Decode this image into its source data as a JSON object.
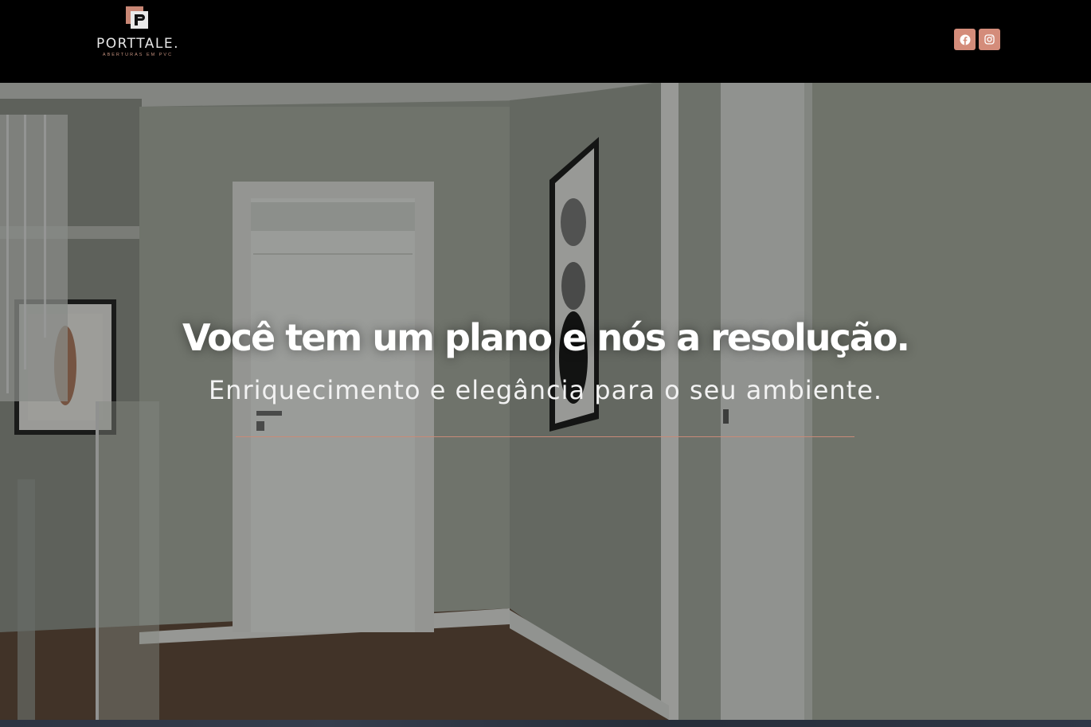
{
  "header": {
    "logo": {
      "icon": "porttale-logo-icon",
      "name": "PORTTALE.",
      "tagline": "ABERTURAS EM PVC"
    },
    "social": [
      {
        "icon": "facebook-icon"
      },
      {
        "icon": "instagram-icon"
      }
    ]
  },
  "hero": {
    "headline": "Você tem um plano e nós a resolução.",
    "subheadline": "Enriquecimento e elegância para o seu ambiente."
  },
  "colors": {
    "accent": "#d48c7a",
    "header_bg": "#000000",
    "text": "#ffffff"
  }
}
